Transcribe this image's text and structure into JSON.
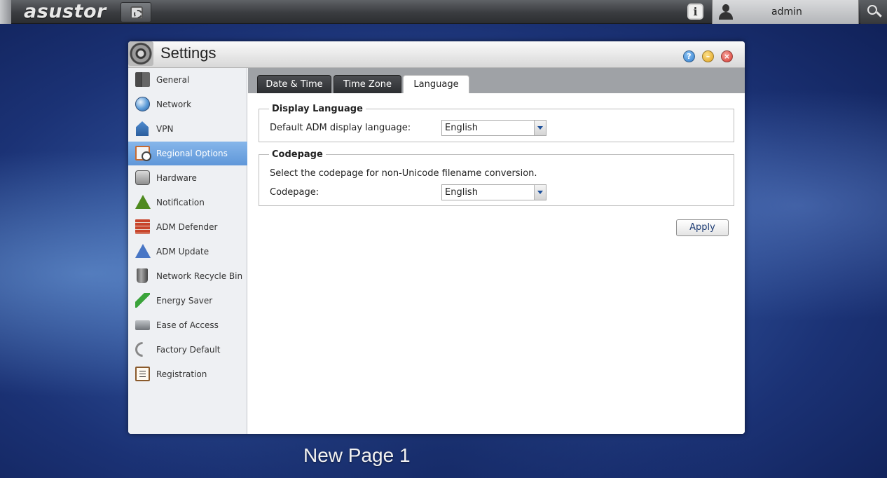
{
  "taskbar": {
    "brand": "asustor",
    "username": "admin"
  },
  "window": {
    "title": "Settings"
  },
  "sidebar": {
    "items": [
      {
        "label": "General",
        "icon": "general-icon"
      },
      {
        "label": "Network",
        "icon": "network-icon"
      },
      {
        "label": "VPN",
        "icon": "vpn-icon"
      },
      {
        "label": "Regional Options",
        "icon": "regional-options-icon",
        "active": true
      },
      {
        "label": "Hardware",
        "icon": "hardware-icon"
      },
      {
        "label": "Notification",
        "icon": "notification-icon"
      },
      {
        "label": "ADM Defender",
        "icon": "adm-defender-icon"
      },
      {
        "label": "ADM Update",
        "icon": "adm-update-icon"
      },
      {
        "label": "Network Recycle Bin",
        "icon": "recycle-bin-icon"
      },
      {
        "label": "Energy Saver",
        "icon": "energy-saver-icon"
      },
      {
        "label": "Ease of Access",
        "icon": "ease-of-access-icon"
      },
      {
        "label": "Factory Default",
        "icon": "factory-default-icon"
      },
      {
        "label": "Registration",
        "icon": "registration-icon"
      }
    ]
  },
  "tabs": [
    {
      "label": "Date & Time"
    },
    {
      "label": "Time Zone"
    },
    {
      "label": "Language",
      "active": true
    }
  ],
  "display_language": {
    "legend": "Display Language",
    "label": "Default ADM display language:",
    "value": "English"
  },
  "codepage": {
    "legend": "Codepage",
    "description": "Select the codepage for non-Unicode filename conversion.",
    "label": "Codepage:",
    "value": "English"
  },
  "apply_label": "Apply",
  "desktop": {
    "page_label": "New Page 1"
  },
  "colors": {
    "active_item": "#6fa5e2",
    "desktop": "#2e4f98"
  }
}
